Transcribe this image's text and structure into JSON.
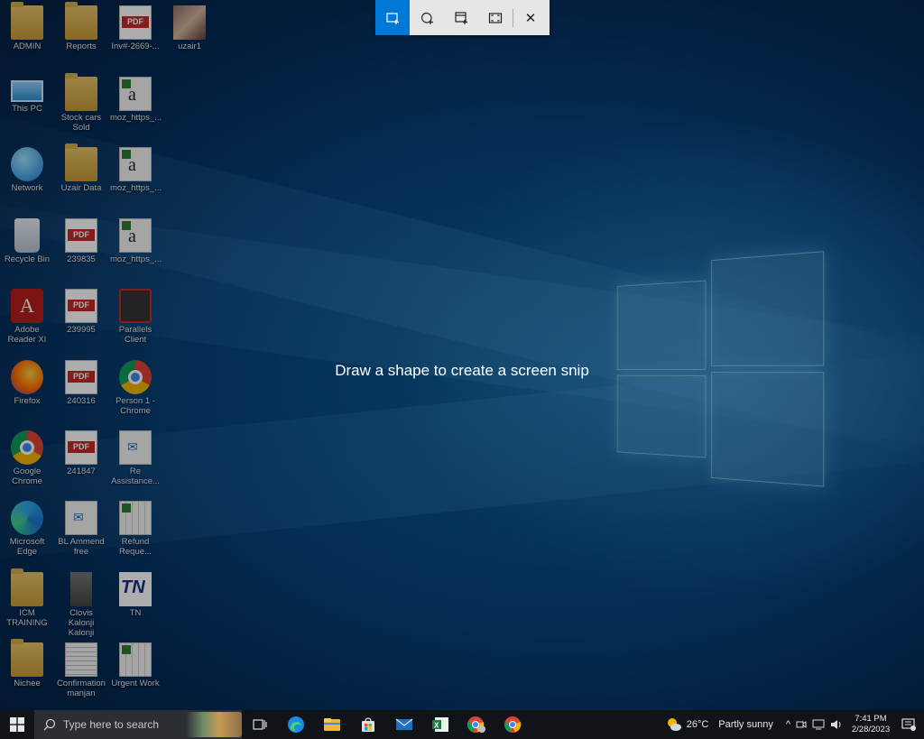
{
  "snip_toolbar": {
    "modes": [
      {
        "name": "Rectangular snip",
        "icon": "rectangle-snip-icon",
        "active": true
      },
      {
        "name": "Freeform snip",
        "icon": "freeform-snip-icon",
        "active": false
      },
      {
        "name": "Window snip",
        "icon": "window-snip-icon",
        "active": false
      },
      {
        "name": "Fullscreen snip",
        "icon": "fullscreen-snip-icon",
        "active": false
      }
    ],
    "close_label": "✕",
    "accent": "#0078d7"
  },
  "hint": "Draw a shape to create a screen snip",
  "desktop_icons": [
    {
      "label": "ADMIN",
      "kind": "folder"
    },
    {
      "label": "This PC",
      "kind": "pc"
    },
    {
      "label": "Network",
      "kind": "network"
    },
    {
      "label": "Recycle Bin",
      "kind": "recycle"
    },
    {
      "label": "Adobe Reader XI",
      "kind": "adobe"
    },
    {
      "label": "Firefox",
      "kind": "firefox"
    },
    {
      "label": "Google Chrome",
      "kind": "chrome"
    },
    {
      "label": "Microsoft Edge",
      "kind": "edge"
    },
    {
      "label": "ICM TRAINING",
      "kind": "folder"
    },
    {
      "label": "Nichee",
      "kind": "folder"
    },
    {
      "label": "Reports",
      "kind": "folder"
    },
    {
      "label": "Stock cars Sold",
      "kind": "folder"
    },
    {
      "label": "Uzair Data",
      "kind": "folder"
    },
    {
      "label": "239835",
      "kind": "pdf"
    },
    {
      "label": "239995",
      "kind": "pdf"
    },
    {
      "label": "240316",
      "kind": "pdf"
    },
    {
      "label": "241847",
      "kind": "pdf"
    },
    {
      "label": "BL Ammend free",
      "kind": "mail"
    },
    {
      "label": "Clovis Kalonji Kalonji",
      "kind": "image"
    },
    {
      "label": "Confirmation manjan",
      "kind": "text"
    },
    {
      "label": "Inv#-2669-...",
      "kind": "pdf"
    },
    {
      "label": "moz_https_...",
      "kind": "font"
    },
    {
      "label": "moz_https_...",
      "kind": "font"
    },
    {
      "label": "moz_https_...",
      "kind": "font"
    },
    {
      "label": "Parallels Client",
      "kind": "parallels"
    },
    {
      "label": "Person 1 - Chrome",
      "kind": "chrome"
    },
    {
      "label": "Re Assistance...",
      "kind": "mail"
    },
    {
      "label": "Refund Reque...",
      "kind": "sheet"
    },
    {
      "label": "TN",
      "kind": "tn"
    },
    {
      "label": "Urgent Work",
      "kind": "sheet"
    },
    {
      "label": "uzair1",
      "kind": "photo"
    }
  ],
  "taskbar": {
    "search_placeholder": "Type here to search",
    "apps": [
      {
        "name": "Task View",
        "icon": "task-view-icon"
      },
      {
        "name": "Microsoft Edge",
        "icon": "edge-icon"
      },
      {
        "name": "File Explorer",
        "icon": "file-explorer-icon"
      },
      {
        "name": "Microsoft Store",
        "icon": "store-icon"
      },
      {
        "name": "Mail",
        "icon": "mail-icon"
      },
      {
        "name": "Excel",
        "icon": "excel-icon"
      },
      {
        "name": "Google Chrome (profile)",
        "icon": "chrome-profile-icon"
      },
      {
        "name": "Google Chrome",
        "icon": "chrome-icon"
      }
    ],
    "weather_temp": "26°C",
    "weather_desc": "Partly sunny",
    "time": "7:41 PM",
    "date": "2/28/2023"
  }
}
